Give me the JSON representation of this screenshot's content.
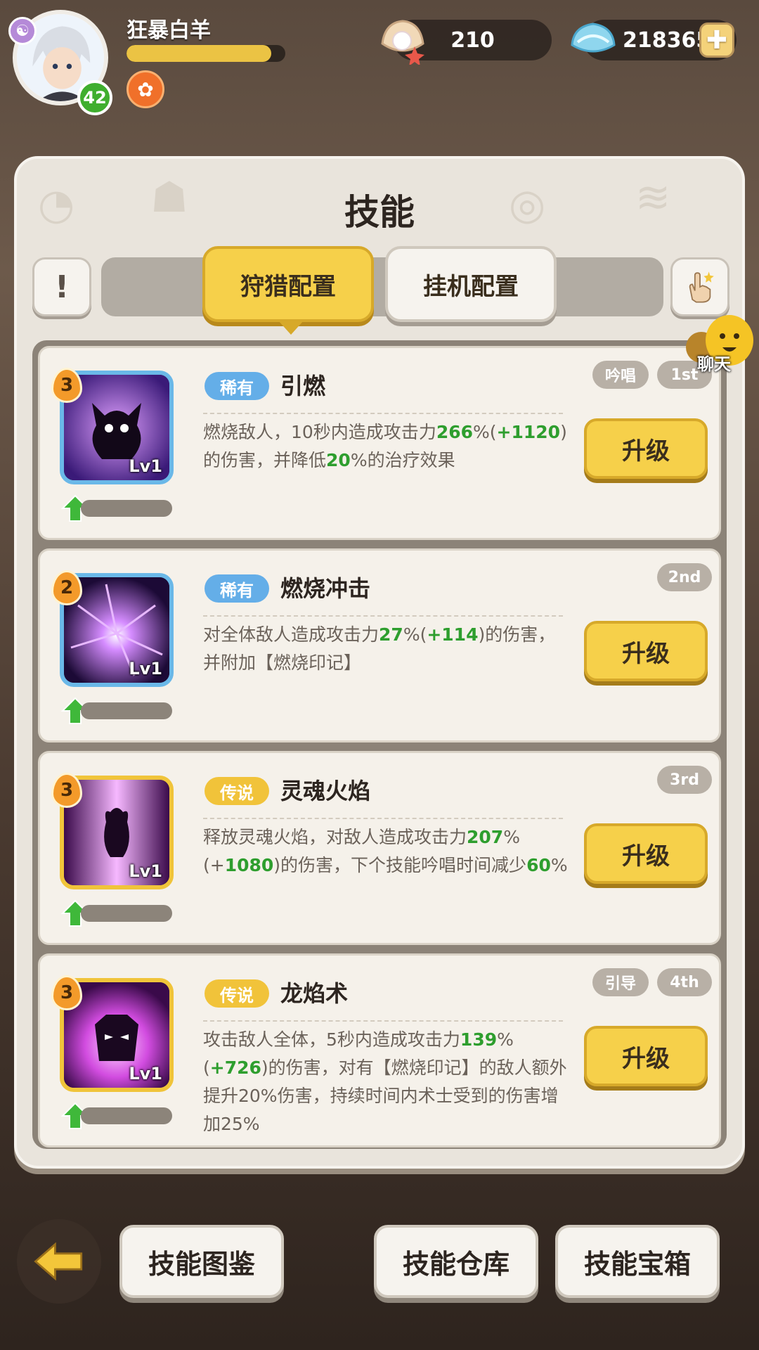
{
  "player": {
    "name": "狂暴白羊",
    "level": "42",
    "exp_fraction": 0.91
  },
  "currency": {
    "pearl": "210",
    "gem": "218365",
    "plus_label": "✚"
  },
  "panel": {
    "title": "技能",
    "info_label": "!",
    "tabs": [
      {
        "label": "狩猎配置",
        "active": true
      },
      {
        "label": "挂机配置",
        "active": false
      }
    ],
    "chat_label": "聊天"
  },
  "skills": [
    {
      "stars": "3",
      "lv": "Lv1",
      "rarity": "稀有",
      "name": "引燃",
      "desc_parts": [
        "燃烧敌人，10秒内造成攻击力",
        "266",
        "%(",
        "+1120",
        ")的伤害，并降低",
        "20",
        "%的治疗效果"
      ],
      "type_tag": "吟唱",
      "order_tag": "1st",
      "button": "升级"
    },
    {
      "stars": "2",
      "lv": "Lv1",
      "rarity": "稀有",
      "name": "燃烧冲击",
      "desc_parts": [
        "对全体敌人造成攻击力",
        "27",
        "%(",
        "+114",
        ")的伤害，并附加【燃烧印记】"
      ],
      "type_tag": "",
      "order_tag": "2nd",
      "button": "升级"
    },
    {
      "stars": "3",
      "lv": "Lv1",
      "rarity": "传说",
      "name": "灵魂火焰",
      "desc_parts": [
        "释放灵魂火焰，对敌人造成攻击力",
        "207",
        "%(+",
        "1080",
        ")的伤害，下个技能吟唱时间减少",
        "60",
        "%"
      ],
      "type_tag": "",
      "order_tag": "3rd",
      "button": "升级"
    },
    {
      "stars": "3",
      "lv": "Lv1",
      "rarity": "传说",
      "name": "龙焰术",
      "desc_parts": [
        "攻击敌人全体，5秒内造成攻击力",
        "139",
        "%(",
        "+726",
        ")的伤害，对有【燃烧印记】的敌人额外提升20%伤害，持续时间内术士受到的伤害增加25%"
      ],
      "type_tag": "引导",
      "order_tag": "4th",
      "button": "升级"
    }
  ],
  "bottom": {
    "btn1": "技能图鉴",
    "btn2": "技能仓库",
    "btn3": "技能宝箱"
  },
  "colors": {
    "highlight": "#2e9e2e",
    "rare": "#64aee8",
    "legend": "#f1c33a",
    "button": "#f6d04a"
  }
}
